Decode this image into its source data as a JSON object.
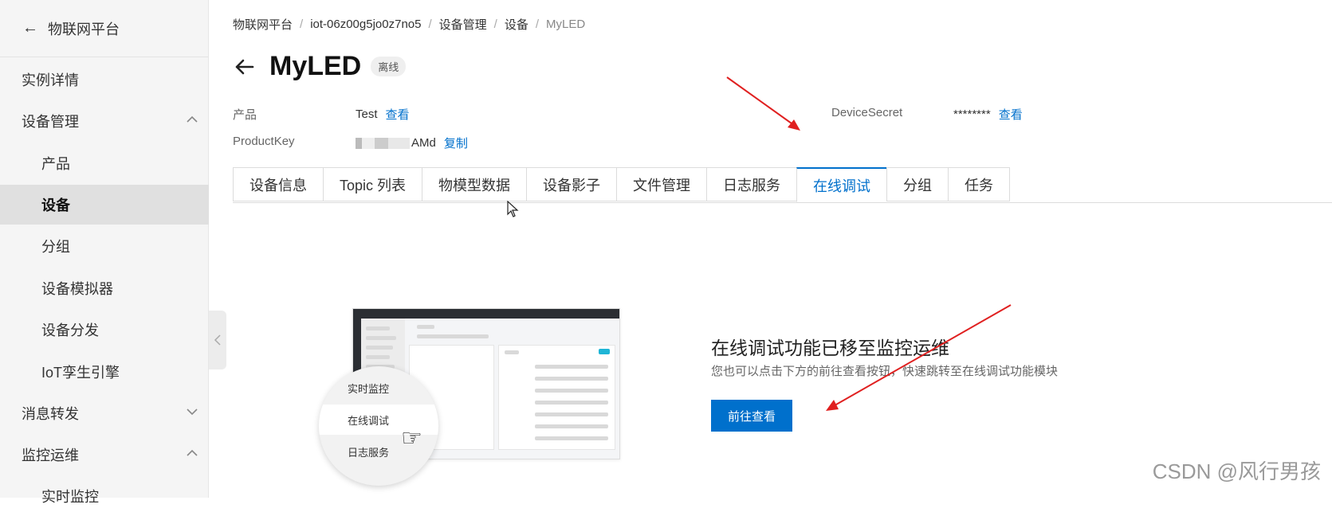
{
  "sidebar": {
    "header": "物联网平台",
    "items": [
      {
        "label": "实例详情"
      },
      {
        "label": "设备管理"
      },
      {
        "label": "产品"
      },
      {
        "label": "设备"
      },
      {
        "label": "分组"
      },
      {
        "label": "设备模拟器"
      },
      {
        "label": "设备分发"
      },
      {
        "label": "IoT孪生引擎"
      },
      {
        "label": "消息转发"
      },
      {
        "label": "监控运维"
      },
      {
        "label": "实时监控"
      }
    ]
  },
  "breadcrumb": [
    "物联网平台",
    "iot-06z00g5jo0z7no5",
    "设备管理",
    "设备",
    "MyLED"
  ],
  "device": {
    "name": "MyLED",
    "status": "离线",
    "product_label": "产品",
    "product_value": "Test",
    "product_link": "查看",
    "productkey_label": "ProductKey",
    "productkey_value": "AMd",
    "productkey_link": "复制",
    "secret_label": "DeviceSecret",
    "secret_value": "********",
    "secret_link": "查看"
  },
  "tabs": [
    "设备信息",
    "Topic 列表",
    "物模型数据",
    "设备影子",
    "文件管理",
    "日志服务",
    "在线调试",
    "分组",
    "任务"
  ],
  "active_tab": "在线调试",
  "illustration": {
    "menu": [
      "实时监控",
      "在线调试",
      "日志服务"
    ]
  },
  "promo": {
    "title": "在线调试功能已移至监控运维",
    "subtitle": "您也可以点击下方的前往查看按钮，快速跳转至在线调试功能模块",
    "button": "前往查看"
  },
  "watermark": "CSDN @风行男孩",
  "colors": {
    "accent": "#0070cc",
    "annotation_arrow": "#e02020"
  }
}
